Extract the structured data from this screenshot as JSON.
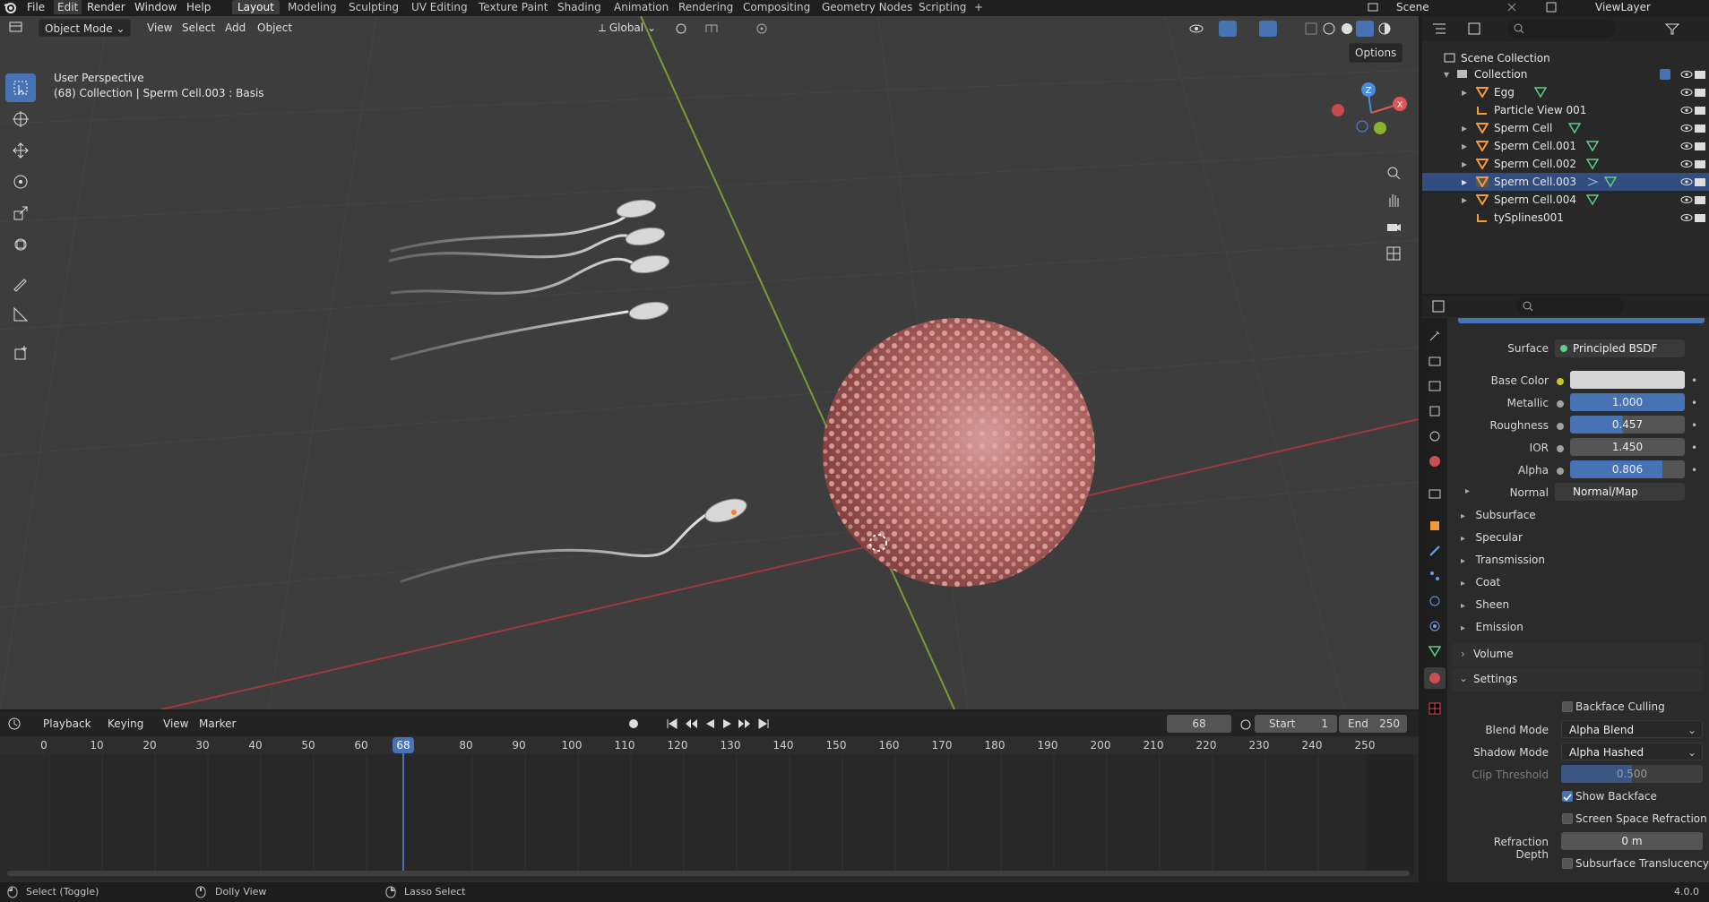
{
  "topbar": {
    "menus": [
      "File",
      "Edit",
      "Render",
      "Window",
      "Help"
    ],
    "workspaces": [
      "Layout",
      "Modeling",
      "Sculpting",
      "UV Editing",
      "Texture Paint",
      "Shading",
      "Animation",
      "Rendering",
      "Compositing",
      "Geometry Nodes",
      "Scripting"
    ],
    "add_tab": "+",
    "scene": "Scene",
    "view_layer": "ViewLayer"
  },
  "viewport": {
    "mode": "Object Mode",
    "menus": [
      "View",
      "Select",
      "Add",
      "Object"
    ],
    "transform_orientation": "Global",
    "options": "Options",
    "overlay_line1": "User Perspective",
    "overlay_line2": "(68) Collection | Sperm Cell.003 : Basis",
    "gizmo_axes": [
      "Z",
      "X"
    ]
  },
  "outliner": {
    "root": "Scene Collection",
    "collection": "Collection",
    "items": [
      {
        "name": "Egg"
      },
      {
        "name": "Particle View 001"
      },
      {
        "name": "Sperm Cell"
      },
      {
        "name": "Sperm Cell.001"
      },
      {
        "name": "Sperm Cell.002"
      },
      {
        "name": "Sperm Cell.003"
      },
      {
        "name": "Sperm Cell.004"
      },
      {
        "name": "tySplines001"
      }
    ]
  },
  "properties": {
    "surface_label": "Surface",
    "surface_value": "Principled BSDF",
    "fields": [
      {
        "label": "Base Color",
        "value": "",
        "fill": 1.0,
        "kind": "color"
      },
      {
        "label": "Metallic",
        "value": "1.000",
        "fill": 1.0,
        "kind": "blue"
      },
      {
        "label": "Roughness",
        "value": "0.457",
        "fill": 0.457,
        "kind": "blue"
      },
      {
        "label": "IOR",
        "value": "1.450",
        "fill": 0.0,
        "kind": "gray"
      },
      {
        "label": "Alpha",
        "value": "0.806",
        "fill": 0.806,
        "kind": "blue"
      },
      {
        "label": "Normal",
        "value": "Normal/Map",
        "fill": 0.0,
        "kind": "dark"
      }
    ],
    "subsections": [
      "Subsurface",
      "Specular",
      "Transmission",
      "Coat",
      "Sheen",
      "Emission"
    ],
    "volume": "Volume",
    "settings": "Settings",
    "backface_culling": "Backface Culling",
    "blend_mode_label": "Blend Mode",
    "blend_mode": "Alpha Blend",
    "shadow_mode_label": "Shadow Mode",
    "shadow_mode": "Alpha Hashed",
    "clip_threshold_label": "Clip Threshold",
    "clip_threshold": "0.500",
    "show_backface": "Show Backface",
    "screen_space_refraction": "Screen Space Refraction",
    "refraction_depth_label": "Refraction Depth",
    "refraction_depth": "0 m",
    "subsurface_translucency": "Subsurface Translucency"
  },
  "timeline": {
    "menus": [
      "Playback",
      "Keying",
      "View",
      "Marker"
    ],
    "current_frame": "68",
    "start_label": "Start",
    "start": "1",
    "end_label": "End",
    "end": "250",
    "ticks": [
      "0",
      "10",
      "20",
      "30",
      "40",
      "50",
      "60",
      "68",
      "80",
      "90",
      "100",
      "110",
      "120",
      "130",
      "140",
      "150",
      "160",
      "170",
      "180",
      "190",
      "200",
      "210",
      "220",
      "230",
      "240",
      "250"
    ]
  },
  "statusbar": {
    "select": "Select (Toggle)",
    "dolly": "Dolly View",
    "lasso": "Lasso Select",
    "version": "4.0.0"
  }
}
